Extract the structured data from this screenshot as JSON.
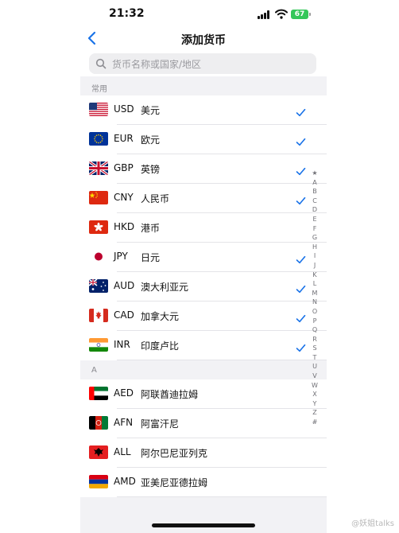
{
  "status": {
    "time": "21:32",
    "battery": "67"
  },
  "nav": {
    "title": "添加货币"
  },
  "search": {
    "placeholder": "货币名称或国家/地区"
  },
  "sections": [
    {
      "header": "常用",
      "rows": [
        {
          "code": "USD",
          "name": "美元",
          "flag": "us-flag",
          "checked": true
        },
        {
          "code": "EUR",
          "name": "欧元",
          "flag": "eu-flag",
          "checked": true
        },
        {
          "code": "GBP",
          "name": "英镑",
          "flag": "uk-flag",
          "checked": true
        },
        {
          "code": "CNY",
          "name": "人民币",
          "flag": "cn-flag",
          "checked": true
        },
        {
          "code": "HKD",
          "name": "港币",
          "flag": "hk-flag",
          "checked": false
        },
        {
          "code": "JPY",
          "name": "日元",
          "flag": "jp-flag",
          "checked": true
        },
        {
          "code": "AUD",
          "name": "澳大利亚元",
          "flag": "au-flag",
          "checked": true
        },
        {
          "code": "CAD",
          "name": "加拿大元",
          "flag": "ca-flag",
          "checked": true
        },
        {
          "code": "INR",
          "name": "印度卢比",
          "flag": "in-flag",
          "checked": true
        }
      ]
    },
    {
      "header": "A",
      "rows": [
        {
          "code": "AED",
          "name": "阿联酋迪拉姆",
          "flag": "ae-flag",
          "checked": false
        },
        {
          "code": "AFN",
          "name": "阿富汗尼",
          "flag": "af-flag",
          "checked": false
        },
        {
          "code": "ALL",
          "name": "阿尔巴尼亚列克",
          "flag": "al-flag",
          "checked": false
        },
        {
          "code": "AMD",
          "name": "亚美尼亚德拉姆",
          "flag": "am-flag",
          "checked": false
        }
      ]
    }
  ],
  "index_letters": [
    "★",
    "A",
    "B",
    "C",
    "D",
    "E",
    "F",
    "G",
    "H",
    "I",
    "J",
    "K",
    "L",
    "M",
    "N",
    "O",
    "P",
    "Q",
    "R",
    "S",
    "T",
    "U",
    "V",
    "W",
    "X",
    "Y",
    "Z",
    "#"
  ],
  "watermark": "@妖姐talks",
  "colors": {
    "accent": "#1a73e8",
    "battery": "#34c759"
  }
}
